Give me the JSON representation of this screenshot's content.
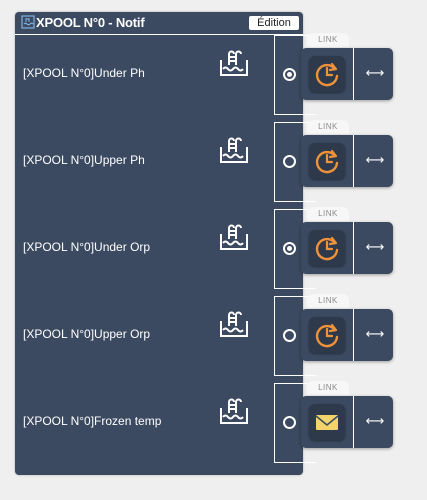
{
  "header": {
    "title": "XPOOL N°0 - Notif",
    "edit_label": "Édition",
    "icon": "pool-icon"
  },
  "link_label": "LINK",
  "arrow_glyph": "⟷",
  "rows": [
    {
      "label": "[XPOOL N°0]Under Ph",
      "selected": true,
      "action_icon": "clock-icon"
    },
    {
      "label": "[XPOOL N°0]Upper Ph",
      "selected": false,
      "action_icon": "clock-icon"
    },
    {
      "label": "[XPOOL N°0]Under Orp",
      "selected": true,
      "action_icon": "clock-icon"
    },
    {
      "label": "[XPOOL N°0]Upper Orp",
      "selected": false,
      "action_icon": "clock-icon"
    },
    {
      "label": "[XPOOL N°0]Frozen temp",
      "selected": false,
      "action_icon": "envelope-icon"
    }
  ],
  "colors": {
    "panel": "#3b4a61",
    "accent_orange": "#f0923a",
    "accent_yellow": "#f2d46b",
    "background": "#efefef"
  }
}
